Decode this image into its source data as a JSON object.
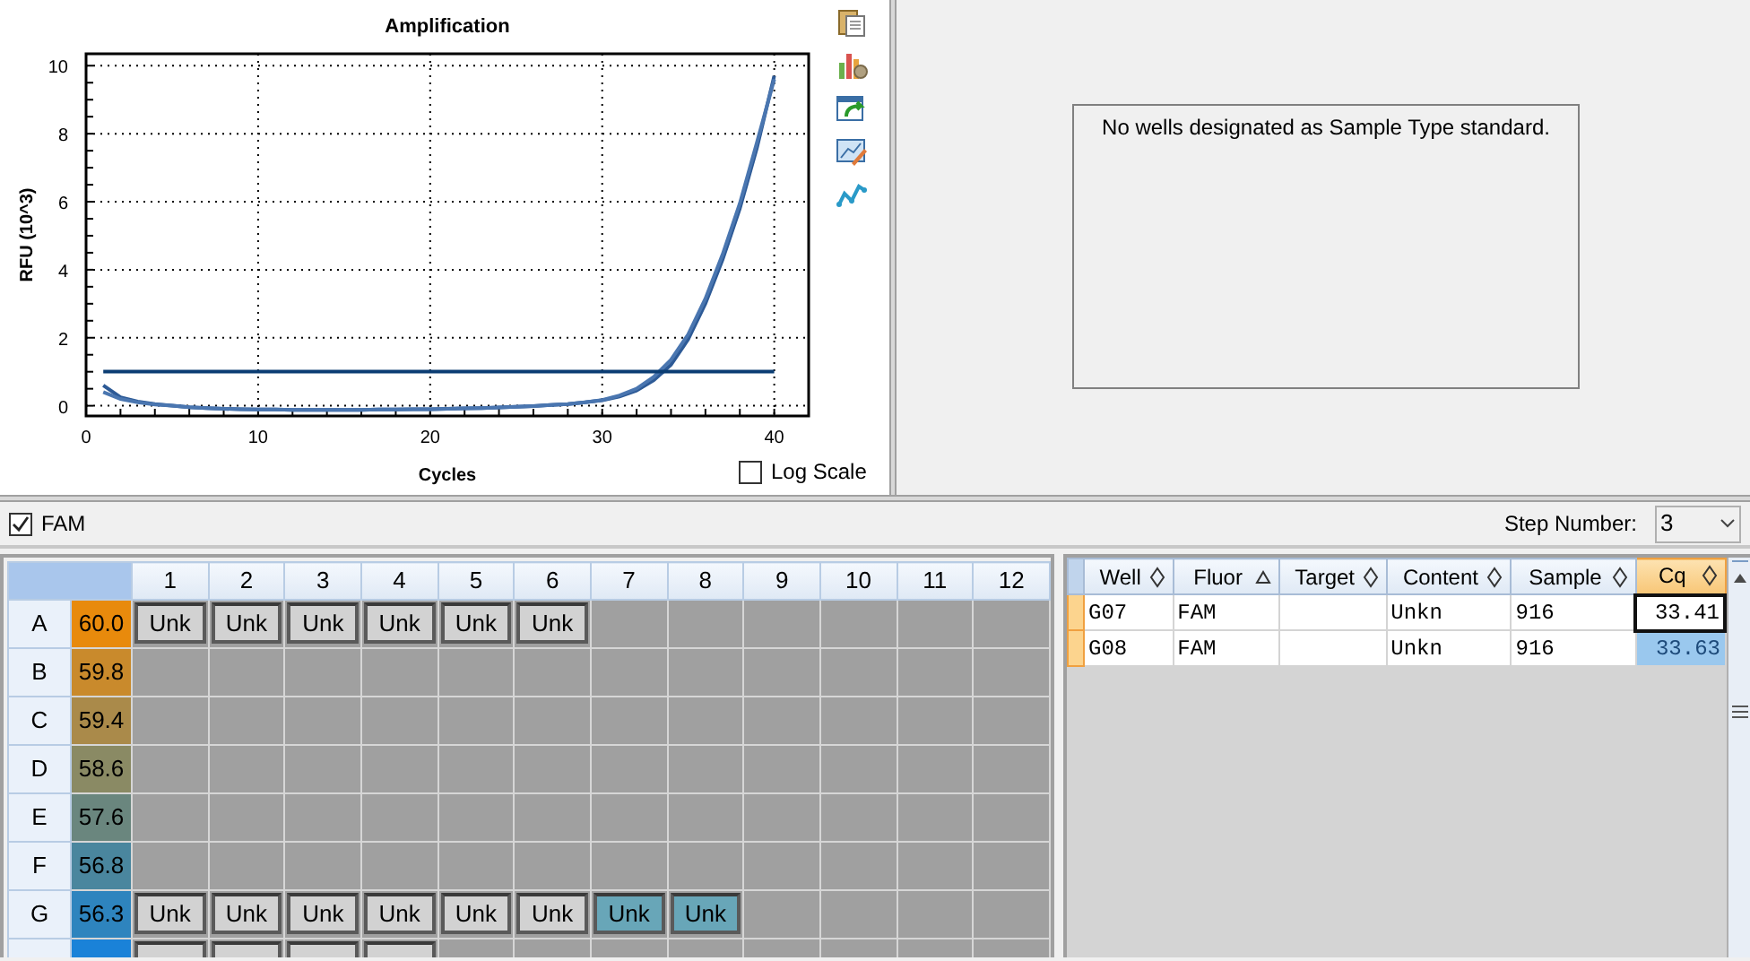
{
  "chart": {
    "chart_data": {
      "type": "line",
      "title": "Amplification",
      "xlabel": "Cycles",
      "ylabel": "RFU (10^3)",
      "x": [
        1,
        2,
        3,
        4,
        5,
        6,
        7,
        8,
        9,
        10,
        11,
        12,
        13,
        14,
        15,
        16,
        17,
        18,
        19,
        20,
        21,
        22,
        23,
        24,
        25,
        26,
        27,
        28,
        29,
        30,
        31,
        32,
        33,
        34,
        35,
        36,
        37,
        38,
        39,
        40
      ],
      "series": [
        {
          "color": "#2d5a96",
          "values": [
            0.6,
            0.25,
            0.12,
            0.05,
            0.0,
            -0.04,
            -0.07,
            -0.09,
            -0.1,
            -0.11,
            -0.11,
            -0.12,
            -0.12,
            -0.12,
            -0.12,
            -0.12,
            -0.11,
            -0.11,
            -0.1,
            -0.1,
            -0.09,
            -0.08,
            -0.07,
            -0.05,
            -0.03,
            -0.01,
            0.02,
            0.05,
            0.1,
            0.16,
            0.27,
            0.45,
            0.75,
            1.2,
            1.95,
            3.0,
            4.3,
            5.8,
            7.6,
            9.7
          ]
        },
        {
          "color": "#4a76b0",
          "values": [
            0.4,
            0.2,
            0.1,
            0.04,
            0.0,
            -0.04,
            -0.07,
            -0.09,
            -0.1,
            -0.11,
            -0.11,
            -0.12,
            -0.12,
            -0.12,
            -0.12,
            -0.12,
            -0.11,
            -0.11,
            -0.1,
            -0.1,
            -0.09,
            -0.08,
            -0.07,
            -0.05,
            -0.03,
            -0.01,
            0.02,
            0.05,
            0.1,
            0.17,
            0.3,
            0.5,
            0.85,
            1.35,
            2.1,
            3.15,
            4.45,
            5.95,
            7.75,
            9.6
          ]
        },
        {
          "color": "#0b3d73",
          "values": [
            1,
            1,
            1,
            1,
            1,
            1,
            1,
            1,
            1,
            1,
            1,
            1,
            1,
            1,
            1,
            1,
            1,
            1,
            1,
            1,
            1,
            1,
            1,
            1,
            1,
            1,
            1,
            1,
            1,
            1,
            1,
            1,
            1,
            1,
            1,
            1,
            1,
            1,
            1,
            1
          ]
        }
      ],
      "xlim": [
        0,
        42
      ],
      "ylim": [
        -0.3,
        10.35
      ],
      "xticks": [
        0,
        10,
        20,
        30,
        40
      ],
      "yticks": [
        0,
        2,
        4,
        6,
        8,
        10
      ],
      "grid": true
    },
    "log_scale": {
      "label": "Log Scale",
      "checked": false
    }
  },
  "standard_curve": {
    "message": "No wells designated as Sample Type standard."
  },
  "fluor_filter": {
    "label": "FAM",
    "checked": true
  },
  "step": {
    "label": "Step Number:",
    "value": "3"
  },
  "plate": {
    "columns": [
      "1",
      "2",
      "3",
      "4",
      "5",
      "6",
      "7",
      "8",
      "9",
      "10",
      "11",
      "12"
    ],
    "rows": [
      {
        "label": "A",
        "temp": "60.0",
        "color": "#e88a0c",
        "wells": [
          {
            "kind": "sample",
            "content": "Unk",
            "selected": false
          },
          {
            "kind": "sample",
            "content": "Unk",
            "selected": false
          },
          {
            "kind": "sample",
            "content": "Unk",
            "selected": false
          },
          {
            "kind": "sample",
            "content": "Unk",
            "selected": false
          },
          {
            "kind": "sample",
            "content": "Unk",
            "selected": false
          },
          {
            "kind": "sample",
            "content": "Unk",
            "selected": false
          },
          {
            "kind": "empty"
          },
          {
            "kind": "empty"
          },
          {
            "kind": "empty"
          },
          {
            "kind": "empty"
          },
          {
            "kind": "empty"
          },
          {
            "kind": "empty"
          }
        ]
      },
      {
        "label": "B",
        "temp": "59.8",
        "color": "#c98a2c",
        "wells": [
          {
            "kind": "empty"
          },
          {
            "kind": "empty"
          },
          {
            "kind": "empty"
          },
          {
            "kind": "empty"
          },
          {
            "kind": "empty"
          },
          {
            "kind": "empty"
          },
          {
            "kind": "empty"
          },
          {
            "kind": "empty"
          },
          {
            "kind": "empty"
          },
          {
            "kind": "empty"
          },
          {
            "kind": "empty"
          },
          {
            "kind": "empty"
          }
        ]
      },
      {
        "label": "C",
        "temp": "59.4",
        "color": "#aa8a4a",
        "wells": [
          {
            "kind": "empty"
          },
          {
            "kind": "empty"
          },
          {
            "kind": "empty"
          },
          {
            "kind": "empty"
          },
          {
            "kind": "empty"
          },
          {
            "kind": "empty"
          },
          {
            "kind": "empty"
          },
          {
            "kind": "empty"
          },
          {
            "kind": "empty"
          },
          {
            "kind": "empty"
          },
          {
            "kind": "empty"
          },
          {
            "kind": "empty"
          }
        ]
      },
      {
        "label": "D",
        "temp": "58.6",
        "color": "#8a8a64",
        "wells": [
          {
            "kind": "empty"
          },
          {
            "kind": "empty"
          },
          {
            "kind": "empty"
          },
          {
            "kind": "empty"
          },
          {
            "kind": "empty"
          },
          {
            "kind": "empty"
          },
          {
            "kind": "empty"
          },
          {
            "kind": "empty"
          },
          {
            "kind": "empty"
          },
          {
            "kind": "empty"
          },
          {
            "kind": "empty"
          },
          {
            "kind": "empty"
          }
        ]
      },
      {
        "label": "E",
        "temp": "57.6",
        "color": "#6a867e",
        "wells": [
          {
            "kind": "empty"
          },
          {
            "kind": "empty"
          },
          {
            "kind": "empty"
          },
          {
            "kind": "empty"
          },
          {
            "kind": "empty"
          },
          {
            "kind": "empty"
          },
          {
            "kind": "empty"
          },
          {
            "kind": "empty"
          },
          {
            "kind": "empty"
          },
          {
            "kind": "empty"
          },
          {
            "kind": "empty"
          },
          {
            "kind": "empty"
          }
        ]
      },
      {
        "label": "F",
        "temp": "56.8",
        "color": "#4a869e",
        "wells": [
          {
            "kind": "empty"
          },
          {
            "kind": "empty"
          },
          {
            "kind": "empty"
          },
          {
            "kind": "empty"
          },
          {
            "kind": "empty"
          },
          {
            "kind": "empty"
          },
          {
            "kind": "empty"
          },
          {
            "kind": "empty"
          },
          {
            "kind": "empty"
          },
          {
            "kind": "empty"
          },
          {
            "kind": "empty"
          },
          {
            "kind": "empty"
          }
        ]
      },
      {
        "label": "G",
        "temp": "56.3",
        "color": "#2e84be",
        "wells": [
          {
            "kind": "sample",
            "content": "Unk",
            "selected": false
          },
          {
            "kind": "sample",
            "content": "Unk",
            "selected": false
          },
          {
            "kind": "sample",
            "content": "Unk",
            "selected": false
          },
          {
            "kind": "sample",
            "content": "Unk",
            "selected": false
          },
          {
            "kind": "sample",
            "content": "Unk",
            "selected": false
          },
          {
            "kind": "sample",
            "content": "Unk",
            "selected": false
          },
          {
            "kind": "sample",
            "content": "Unk",
            "selected": true
          },
          {
            "kind": "sample",
            "content": "Unk",
            "selected": true
          },
          {
            "kind": "empty"
          },
          {
            "kind": "empty"
          },
          {
            "kind": "empty"
          },
          {
            "kind": "empty"
          }
        ]
      },
      {
        "color": "#1a82d8",
        "wells": [
          {
            "kind": "sample",
            "selected": false
          },
          {
            "kind": "sample",
            "selected": false
          },
          {
            "kind": "sample",
            "selected": false
          },
          {
            "kind": "sample",
            "selected": false
          },
          {
            "kind": "empty"
          },
          {
            "kind": "empty"
          },
          {
            "kind": "empty"
          },
          {
            "kind": "empty"
          },
          {
            "kind": "empty"
          },
          {
            "kind": "empty"
          },
          {
            "kind": "empty"
          },
          {
            "kind": "empty"
          }
        ]
      }
    ]
  },
  "results": {
    "columns": [
      {
        "label": "Well",
        "sorted": false,
        "selected": false
      },
      {
        "label": "Fluor",
        "sorted": true,
        "selected": false
      },
      {
        "label": "Target",
        "sorted": false,
        "selected": false
      },
      {
        "label": "Content",
        "sorted": false,
        "selected": false
      },
      {
        "label": "Sample",
        "sorted": false,
        "selected": false
      },
      {
        "label": "Cq",
        "sorted": false,
        "selected": true
      }
    ],
    "rows": [
      {
        "well": "G07",
        "fluor": "FAM",
        "content": "Unkn",
        "sample": "916",
        "cq": "33.41",
        "focused": true
      },
      {
        "well": "G08",
        "fluor": "FAM",
        "content": "Unkn",
        "sample": "916",
        "cq": "33.63",
        "focused": false
      }
    ]
  }
}
